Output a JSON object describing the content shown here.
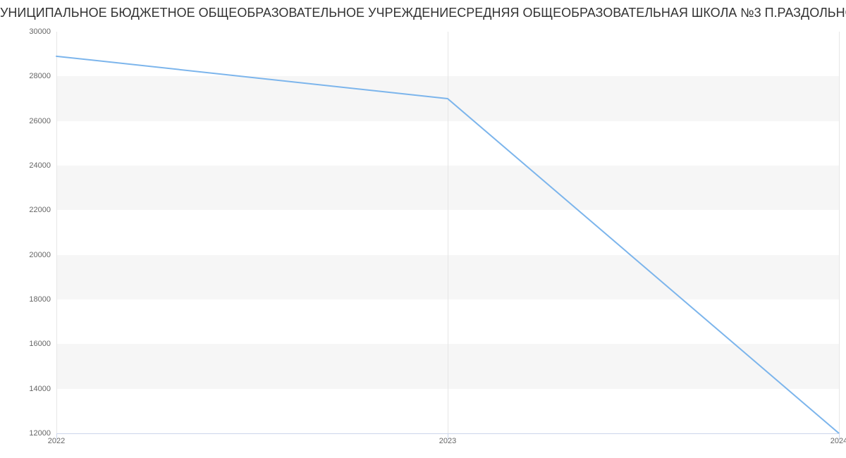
{
  "chart_data": {
    "type": "line",
    "title": "УНИЦИПАЛЬНОЕ БЮДЖЕТНОЕ ОБЩЕОБРАЗОВАТЕЛЬНОЕ УЧРЕЖДЕНИЕСРЕДНЯЯ ОБЩЕОБРАЗОВАТЕЛЬНАЯ ШКОЛА №3 П.РАЗДОЛЬНОЕ НАДЕЖДИНСКОГО РАЙОНА | Данн",
    "x": [
      2022,
      2023,
      2024
    ],
    "values": [
      28900,
      27000,
      12000
    ],
    "xlabel": "",
    "ylabel": "",
    "ylim": [
      12000,
      30000
    ],
    "xlim": [
      2022,
      2024
    ],
    "y_ticks": [
      12000,
      14000,
      16000,
      18000,
      20000,
      22000,
      24000,
      26000,
      28000,
      30000
    ],
    "x_ticks": [
      2022,
      2023,
      2024
    ],
    "line_color": "#7cb5ec"
  }
}
